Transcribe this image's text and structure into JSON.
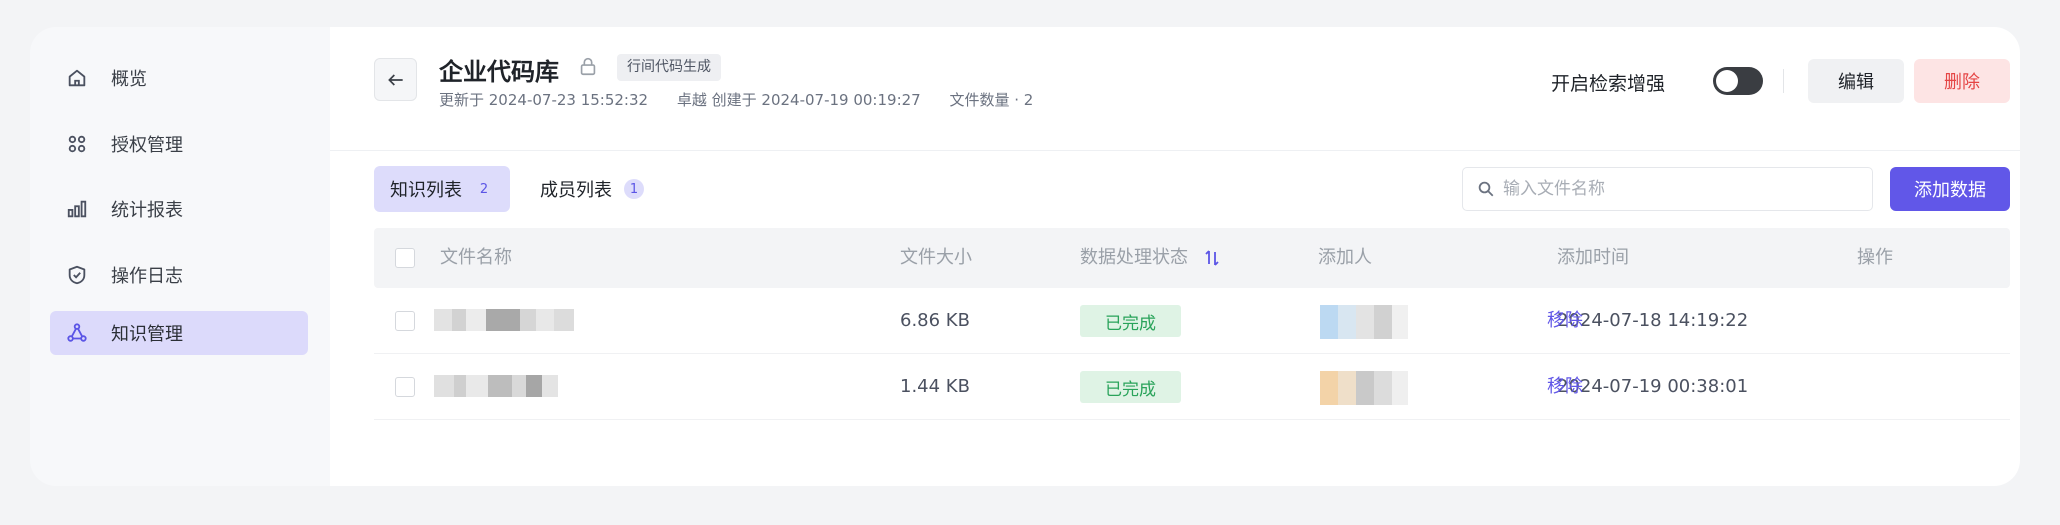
{
  "sidebar": {
    "items": [
      {
        "label": "概览",
        "icon": "home-icon"
      },
      {
        "label": "授权管理",
        "icon": "apps-icon"
      },
      {
        "label": "统计报表",
        "icon": "bar-chart-icon"
      },
      {
        "label": "操作日志",
        "icon": "shield-icon"
      },
      {
        "label": "知识管理",
        "icon": "network-icon",
        "active": true
      }
    ]
  },
  "header": {
    "title": "企业代码库",
    "tag": "行间代码生成",
    "updated": "更新于 2024-07-23 15:52:32",
    "created": "卓越 创建于 2024-07-19 00:19:27",
    "file_count": "文件数量 · 2",
    "toggle_label": "开启检索增强",
    "toggle_on": false,
    "edit_label": "编辑",
    "delete_label": "删除"
  },
  "tabs": [
    {
      "label": "知识列表",
      "count": "2",
      "active": true
    },
    {
      "label": "成员列表",
      "count": "1",
      "active": false
    }
  ],
  "search": {
    "placeholder": "输入文件名称"
  },
  "add_button": "添加数据",
  "table": {
    "columns": [
      "文件名称",
      "文件大小",
      "数据处理状态",
      "添加人",
      "添加时间",
      "操作"
    ],
    "rows": [
      {
        "size": "6.86 KB",
        "status": "已完成",
        "time": "2024-07-18 14:19:22",
        "action": "移除"
      },
      {
        "size": "1.44 KB",
        "status": "已完成",
        "time": "2024-07-19 00:38:01",
        "action": "移除"
      }
    ]
  },
  "colors": {
    "accent": "#6157e8",
    "danger": "#e54545",
    "success": "#29a35a"
  }
}
